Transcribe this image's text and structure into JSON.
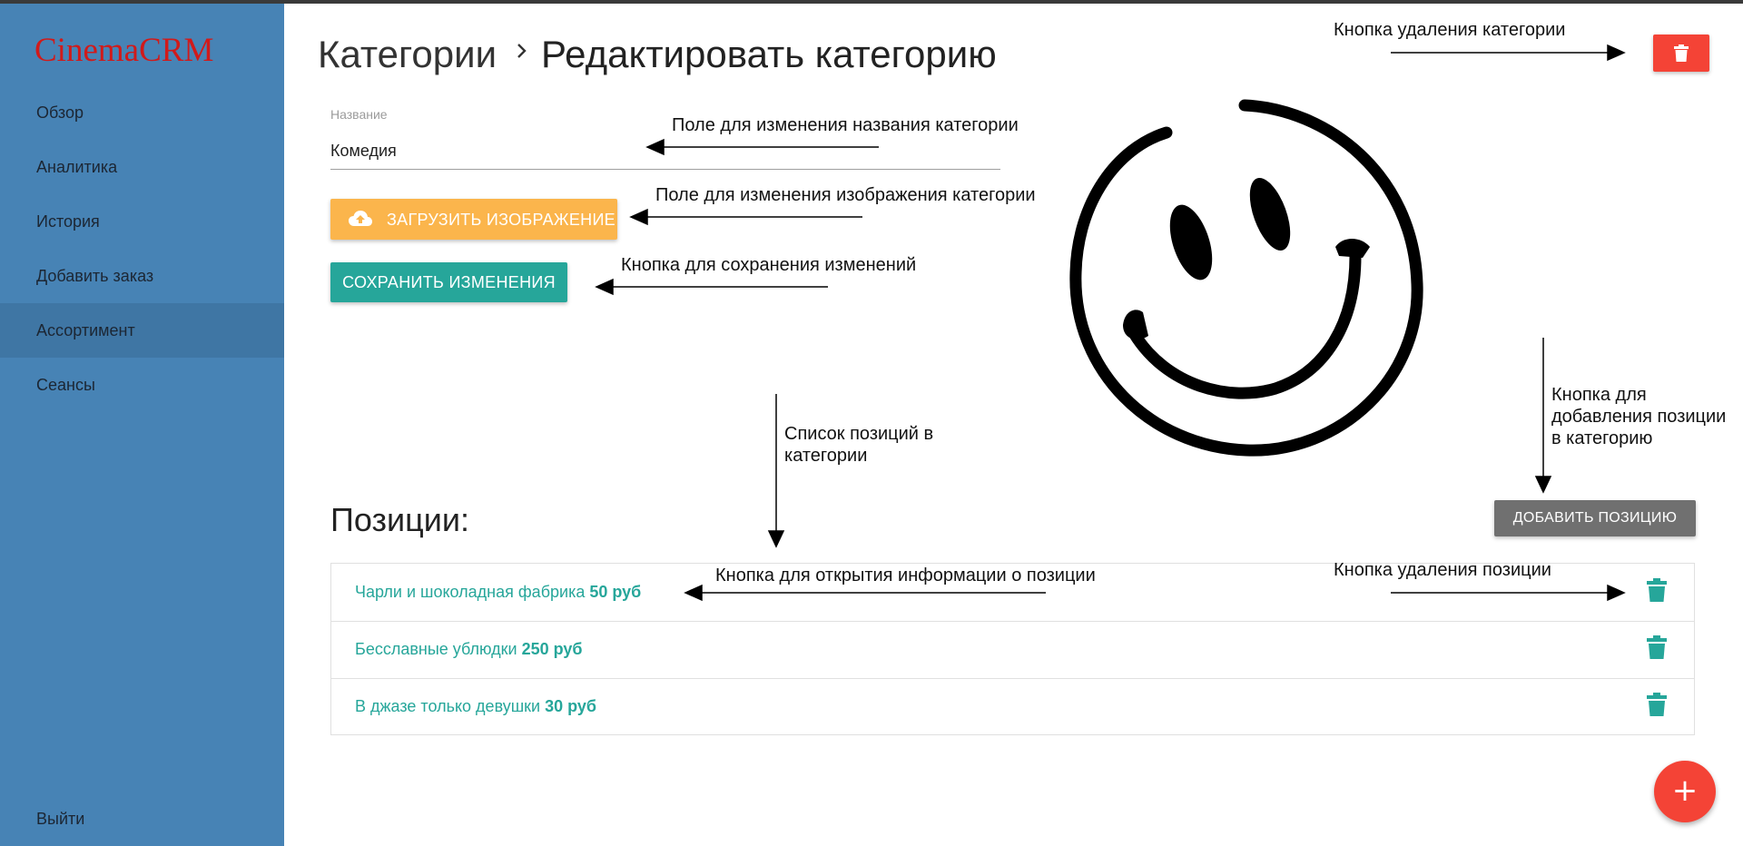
{
  "app": {
    "logo": "CinemaCRM"
  },
  "sidebar": {
    "items": [
      {
        "label": "Обзор"
      },
      {
        "label": "Аналитика"
      },
      {
        "label": "История"
      },
      {
        "label": "Добавить заказ"
      },
      {
        "label": "Ассортимент",
        "active": true
      },
      {
        "label": "Сеансы"
      }
    ],
    "logout": "Выйти"
  },
  "header": {
    "breadcrumb": "Категории",
    "title": "Редактировать категорию"
  },
  "form": {
    "name_label": "Название",
    "name_value": "Комедия",
    "upload_label": "Загрузить изображение",
    "save_label": "Сохранить изменения"
  },
  "positions": {
    "title": "Позиции:",
    "add_label": "Добавить позицию",
    "items": [
      {
        "name": "Чарли и шоколадная фабрика",
        "price": "50 руб"
      },
      {
        "name": "Бесславные ублюдки",
        "price": "250 руб"
      },
      {
        "name": "В джазе только девушки",
        "price": "30 руб"
      }
    ]
  },
  "fab": {
    "label": "+"
  },
  "annotations": {
    "delete_category": "Кнопка удаления категории",
    "name_field": "Поле для изменения названия категории",
    "image_field": "Поле для изменения изображения категории",
    "save_button": "Кнопка для сохранения изменений",
    "positions_list_1": "Список позиций в",
    "positions_list_2": "категории",
    "add_position_1": "Кнопка для",
    "add_position_2": "добавления позиции",
    "add_position_3": "в категорию",
    "open_position": "Кнопка для открытия информации о позиции",
    "delete_position": "Кнопка удаления позиции"
  },
  "colors": {
    "sidebar": "#4783b5",
    "sidebar_active": "#3f76a4",
    "logo": "#d11a1a",
    "accent": "#26a69a",
    "upload": "#fbb54c",
    "danger": "#f44336",
    "add_button": "#707070"
  },
  "icons": [
    "cloud-upload-icon",
    "trash-icon",
    "chevron-right-icon",
    "plus-icon",
    "smiley-image"
  ]
}
